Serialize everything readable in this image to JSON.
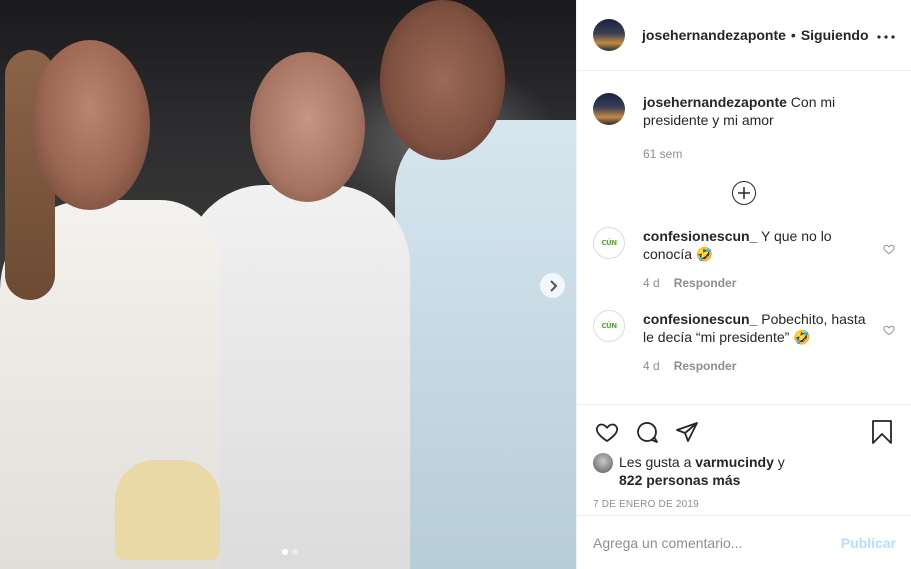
{
  "post": {
    "username": "josehernandezaponte",
    "separator": "•",
    "follow_status": "Siguiendo",
    "more_label": "•••",
    "caption_text": " Con mi presidente y mi amor",
    "caption_time": "61 sem",
    "load_more_label": "+"
  },
  "comments": [
    {
      "user": "confesionescun_",
      "text": " Y que no lo conocía 🤣",
      "time": "4 d",
      "reply": "Responder"
    },
    {
      "user": "confesionescun_",
      "text": " Pobechito, hasta le decía “mi presidente” 🤣",
      "time": "4 d",
      "reply": "Responder"
    }
  ],
  "icons": {
    "like": "heart-icon",
    "comment": "comment-icon",
    "share": "paper-plane-icon",
    "save": "bookmark-icon",
    "next": "chevron-right-icon",
    "add": "plus-circle-icon",
    "comment_like": "heart-icon"
  },
  "likes": {
    "prefix": "Les gusta a ",
    "user": "varmucindy",
    "middle": " y ",
    "count": "822 personas más"
  },
  "date": "7 DE ENERO DE 2019",
  "comment_box": {
    "placeholder": "Agrega un comentario...",
    "post_label": "Publicar"
  },
  "colors": {
    "text": "#262626",
    "muted": "#8e8e8e",
    "border": "#efefef",
    "post_disabled": "#b2dffc"
  },
  "carousel": {
    "current": 1,
    "total": 2
  }
}
